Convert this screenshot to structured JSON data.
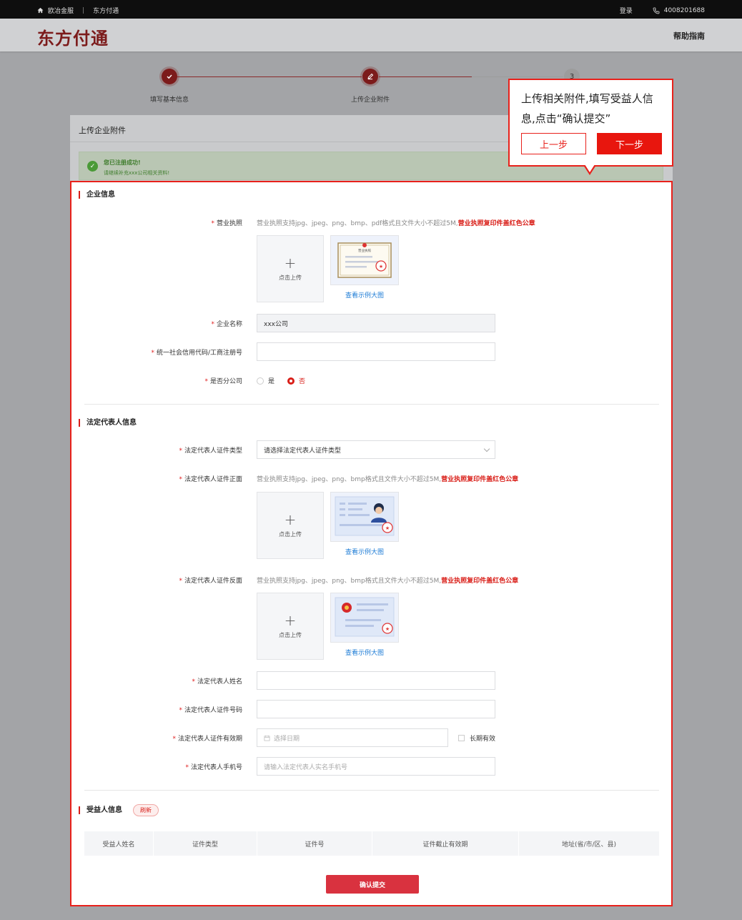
{
  "topbar": {
    "home": "欧冶金服",
    "site": "东方付通",
    "login": "登录",
    "phone": "4008201688"
  },
  "header": {
    "logo": "东方付通",
    "help": "帮助指南"
  },
  "steps": [
    {
      "label": "填写基本信息",
      "state": "done"
    },
    {
      "label": "上传企业附件",
      "state": "current"
    },
    {
      "label": "3",
      "state": "todo"
    }
  ],
  "page": {
    "title": "上传企业附件",
    "success_title": "您已注册成功!",
    "success_sub": "请继续补充xxx公司相关资料!"
  },
  "company": {
    "section": "企业信息",
    "license_label": "营业执照",
    "license_hint": "营业执照支持jpg、jpeg、png、bmp、pdf格式且文件大小不超过5M,",
    "license_hint_red": "营业执照复印件盖红色公章",
    "upload_text": "点击上传",
    "sample_title": "营业执照",
    "sample_link": "查看示例大图",
    "name_label": "企业名称",
    "name_value": "xxx公司",
    "credit_label": "统一社会信用代码/工商注册号",
    "branch_label": "是否分公司",
    "branch_yes": "是",
    "branch_no": "否"
  },
  "legal": {
    "section": "法定代表人信息",
    "idtype_label": "法定代表人证件类型",
    "idtype_placeholder": "请选择法定代表人证件类型",
    "front_label": "法定代表人证件正面",
    "back_label": "法定代表人证件反面",
    "id_hint": "营业执照支持jpg、jpeg、png、bmp格式且文件大小不超过5M,",
    "id_hint_red": "营业执照复印件盖红色公章",
    "upload_text": "点击上传",
    "sample_link": "查看示例大图",
    "name_label": "法定代表人姓名",
    "idno_label": "法定代表人证件号码",
    "validity_label": "法定代表人证件有效期",
    "date_placeholder": "选择日期",
    "longterm": "长期有效",
    "mobile_label": "法定代表人手机号",
    "mobile_placeholder": "请输入法定代表人实名手机号"
  },
  "beneficiary": {
    "section": "受益人信息",
    "refresh": "刷新",
    "columns": [
      "受益人姓名",
      "证件类型",
      "证件号",
      "证件截止有效期",
      "地址(省/市/区、县)"
    ]
  },
  "submit": "确认提交",
  "tooltip": {
    "text": "上传相关附件,填写受益人信息,点击“确认提交”",
    "prev": "上一步",
    "next": "下一步"
  },
  "colors": {
    "brand": "#7c1b1b",
    "accent": "#d91e18",
    "highlight": "#e8211b",
    "link": "#1e7cd6"
  }
}
